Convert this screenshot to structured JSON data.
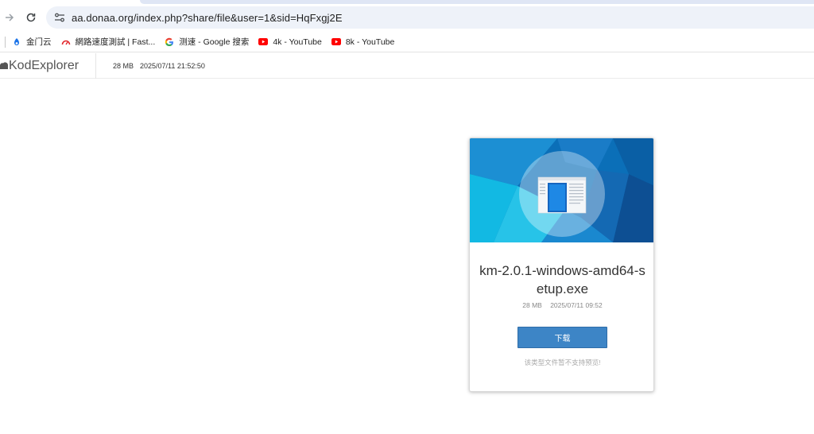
{
  "browser": {
    "url": "aa.donaa.org/index.php?share/file&user=1&sid=HqFxgj2E"
  },
  "bookmarks": [
    {
      "label": "金门云",
      "icon": "kinmen-cloud-icon",
      "color": "#1a73e8"
    },
    {
      "label": "網路速度測試 | Fast...",
      "icon": "fast-speedometer-icon",
      "color": "#e2272c"
    },
    {
      "label": "测速 - Google 搜索",
      "icon": "google-icon",
      "color": "#4285f4"
    },
    {
      "label": "4k - YouTube",
      "icon": "youtube-icon",
      "color": "#ff0000"
    },
    {
      "label": "8k - YouTube",
      "icon": "youtube-icon",
      "color": "#ff0000"
    }
  ],
  "header": {
    "logo": "KodExplorer",
    "size": "28 MB",
    "datetime": "2025/07/11 21:52:50"
  },
  "file": {
    "name": "km-2.0.1-windows-amd64-setup.exe",
    "size": "28 MB",
    "datetime": "2025/07/11 09:52",
    "download_label": "下载",
    "preview_note": "该类型文件暂不支持预览!"
  },
  "colors": {
    "accent": "#3d85c6",
    "banner_dark": "#0b6fb8",
    "banner_light": "#27c3e8"
  }
}
